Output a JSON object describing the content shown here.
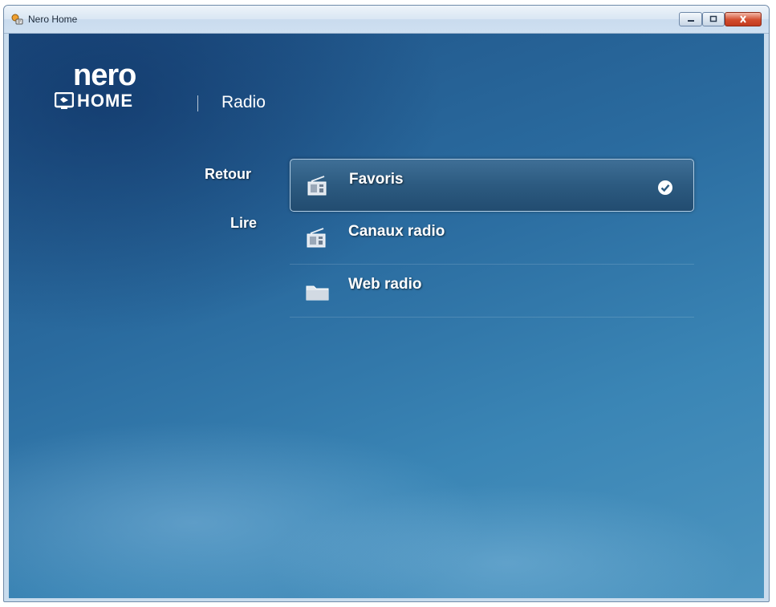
{
  "window": {
    "title": "Nero Home"
  },
  "logo": {
    "brand": "nero",
    "product": "HOME"
  },
  "section_title": "Radio",
  "side_actions": {
    "back": "Retour",
    "play": "Lire"
  },
  "menu": {
    "items": [
      {
        "label": "Favoris",
        "icon": "radio-icon",
        "selected": true
      },
      {
        "label": "Canaux radio",
        "icon": "radio-icon",
        "selected": false
      },
      {
        "label": "Web radio",
        "icon": "folder-icon",
        "selected": false
      }
    ]
  },
  "colors": {
    "accent": "#2a6b9f",
    "selection": "#2c5a80"
  }
}
